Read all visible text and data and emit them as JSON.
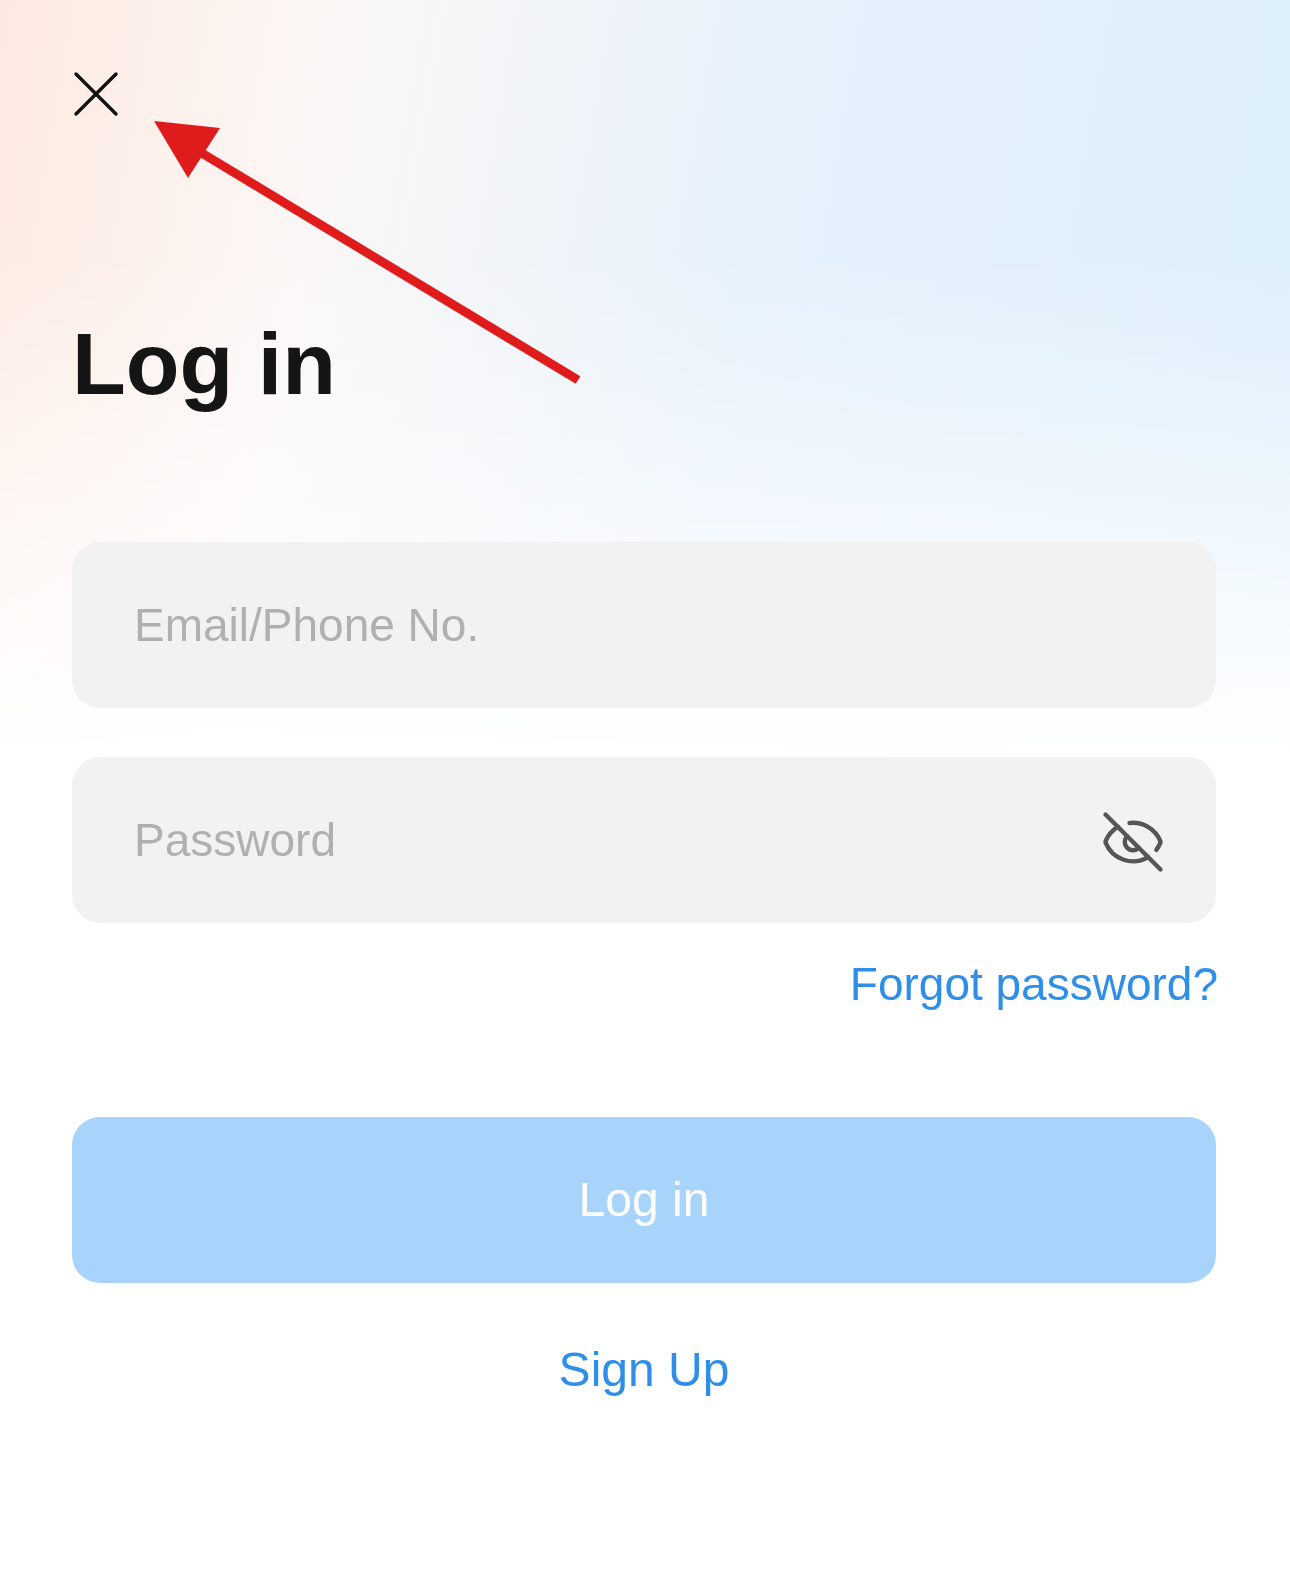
{
  "title": "Log in",
  "fields": [
    {
      "kind": "text",
      "placeholder": "Email/Phone No."
    },
    {
      "kind": "password",
      "placeholder": "Password",
      "password_visible": false
    }
  ],
  "forgot_link": "Forgot password?",
  "login_button": {
    "label": "Log in",
    "disabled": true
  },
  "signup_link": "Sign Up"
}
